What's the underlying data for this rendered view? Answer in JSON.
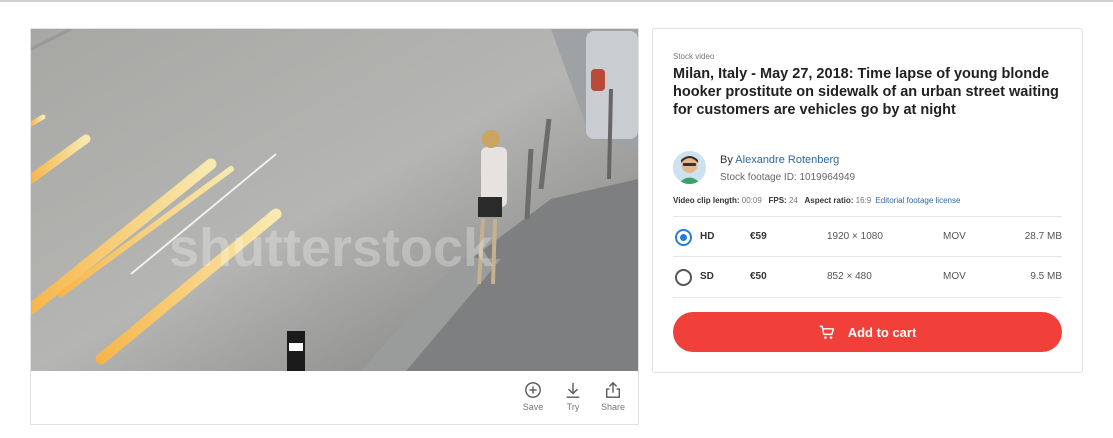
{
  "preview": {
    "image_alt": "Time lapse street scene at night",
    "watermark": "shutterstock",
    "actions": [
      {
        "label": "Save",
        "icon": "plus-circle-icon"
      },
      {
        "label": "Try",
        "icon": "download-icon"
      },
      {
        "label": "Share",
        "icon": "share-icon"
      }
    ]
  },
  "details": {
    "type_label": "Stock video",
    "title": "Milan, Italy - May 27, 2018: Time lapse of young blonde hooker prostitute on sidewalk of an urban street waiting for customers are vehicles go by at night",
    "by_prefix": "By",
    "author": "Alexandre Rotenberg",
    "stock_id": "Stock footage ID: 1019964949",
    "meta": {
      "length_label": "Video clip length:",
      "length_value": "00:09",
      "fps_label": "FPS:",
      "fps_value": "24",
      "aspect_label": "Aspect ratio:",
      "aspect_value": "16:9",
      "license_link": "Editorial footage license"
    }
  },
  "options": [
    {
      "quality": "HD",
      "price": "€59",
      "resolution": "1920 × 1080",
      "format": "MOV",
      "size": "28.7 MB",
      "selected": true
    },
    {
      "quality": "SD",
      "price": "€50",
      "resolution": "852 × 480",
      "format": "MOV",
      "size": "9.5 MB",
      "selected": false
    }
  ],
  "cart": {
    "label": "Add to cart",
    "icon": "cart-icon"
  },
  "colors": {
    "accent": "#f1403a",
    "link": "#2c6aa0",
    "radio_selected": "#2b7bd4"
  }
}
